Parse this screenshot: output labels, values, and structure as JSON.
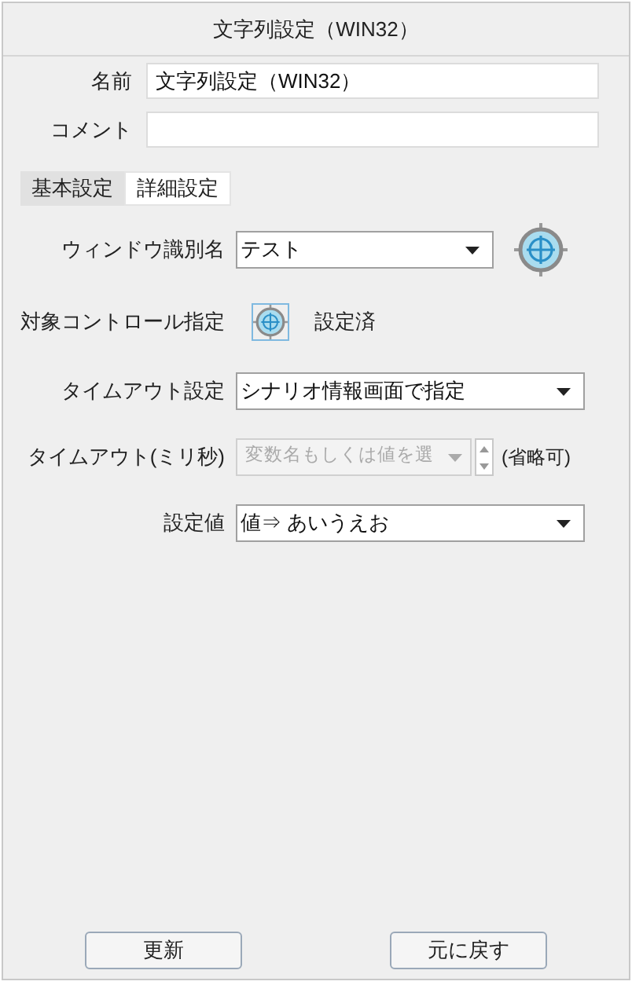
{
  "window": {
    "title": "文字列設定（WIN32）"
  },
  "fields": [
    {
      "label": "名前",
      "value": "文字列設定（WIN32）"
    },
    {
      "label": "コメント"
    }
  ],
  "tabs": [
    {
      "label": "基本設定",
      "selected": true
    },
    {
      "label": "詳細設定",
      "selected": false
    }
  ],
  "rows": [
    {
      "kind": "combo-target",
      "label": "ウィンドウ識別名",
      "value": "テスト"
    },
    {
      "kind": "target",
      "label": "対象コントロール指定",
      "status": "設定済"
    },
    {
      "kind": "combo",
      "label": "タイムアウト設定",
      "value": "シナリオ情報画面で指定"
    },
    {
      "kind": "spin",
      "label": "タイムアウト(ミリ秒)",
      "placeholder": "変数名もしくは値を選",
      "disabled": true,
      "note": "(省略可)"
    },
    {
      "kind": "combo",
      "label": "設定値",
      "value": "値⇒ あいうえお"
    }
  ],
  "buttons": [
    "更新",
    "元に戻す"
  ]
}
